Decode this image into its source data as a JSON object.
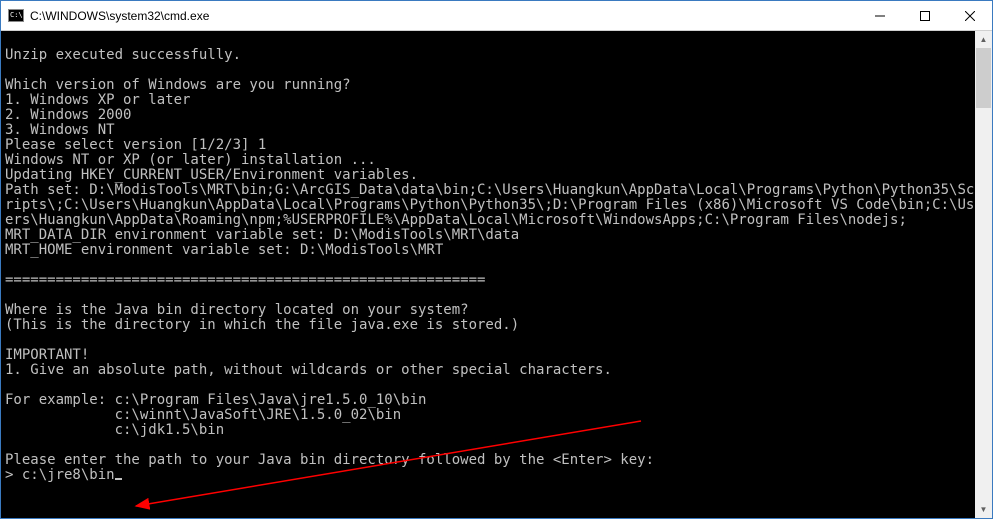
{
  "titlebar": {
    "title": "C:\\WINDOWS\\system32\\cmd.exe"
  },
  "terminal": {
    "lines": [
      "",
      "Unzip executed successfully.",
      "",
      "Which version of Windows are you running?",
      "1. Windows XP or later",
      "2. Windows 2000",
      "3. Windows NT",
      "Please select version [1/2/3] 1",
      "Windows NT or XP (or later) installation ...",
      "Updating HKEY_CURRENT_USER/Environment variables.",
      "Path set: D:\\ModisTools\\MRT\\bin;G:\\ArcGIS_Data\\data\\bin;C:\\Users\\Huangkun\\AppData\\Local\\Programs\\Python\\Python35\\Scripts\\;C:\\Users\\Huangkun\\AppData\\Local\\Programs\\Python\\Python35\\;D:\\Program Files (x86)\\Microsoft VS Code\\bin;C:\\Users\\Huangkun\\AppData\\Roaming\\npm;%USERPROFILE%\\AppData\\Local\\Microsoft\\WindowsApps;C:\\Program Files\\nodejs;",
      "MRT_DATA_DIR environment variable set: D:\\ModisTools\\MRT\\data",
      "MRT_HOME environment variable set: D:\\ModisTools\\MRT",
      "",
      "=========================================================",
      "",
      "Where is the Java bin directory located on your system?",
      "(This is the directory in which the file java.exe is stored.)",
      "",
      "IMPORTANT!",
      "1. Give an absolute path, without wildcards or other special characters.",
      "",
      "For example: c:\\Program Files\\Java\\jre1.5.0_10\\bin",
      "             c:\\winnt\\JavaSoft\\JRE\\1.5.0_02\\bin",
      "             c:\\jdk1.5\\bin",
      "",
      "Please enter the path to your Java bin directory followed by the <Enter> key:",
      "> c:\\jre8\\bin"
    ]
  },
  "annotation": {
    "arrow_color": "#ff0000"
  }
}
